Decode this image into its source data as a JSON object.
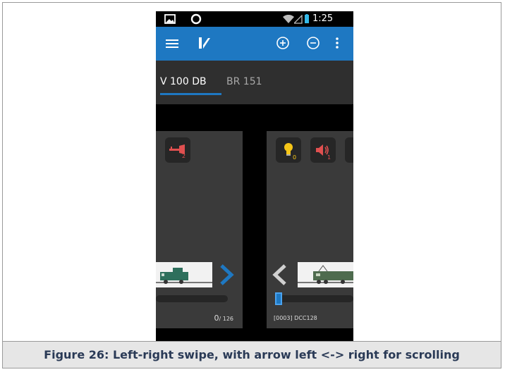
{
  "status_bar": {
    "time": "1:25",
    "icons": [
      "image-icon",
      "circle-icon",
      "wifi-icon",
      "signal-icon",
      "battery-icon"
    ]
  },
  "app_bar": {
    "icons": [
      "menu-icon",
      "app-logo-icon",
      "add-circle-icon",
      "remove-circle-icon",
      "overflow-menu-icon"
    ]
  },
  "tabs": [
    {
      "label": "V 100 DB",
      "active": true
    },
    {
      "label": "BR 151",
      "active": false
    }
  ],
  "left_panel": {
    "function_button": {
      "index": "2",
      "icon": "horn-icon"
    },
    "speed_readout": "0",
    "speed_max": "/ 126",
    "arrow": "chevron-right-icon"
  },
  "right_panel": {
    "function_buttons": [
      {
        "index": "0",
        "icon": "light-bulb-icon"
      },
      {
        "index": "1",
        "icon": "speaker-icon"
      }
    ],
    "address": "[0003]",
    "protocol": "DCC128",
    "arrow": "chevron-left-icon",
    "speed_level": 0
  },
  "caption": "Figure 26: Left-right swipe, with arrow left <-> right for scrolling",
  "colors": {
    "accent": "#1e78c2",
    "panel": "#3a3a3a",
    "bulb": "#f5c518",
    "fn_red": "#e05050"
  }
}
